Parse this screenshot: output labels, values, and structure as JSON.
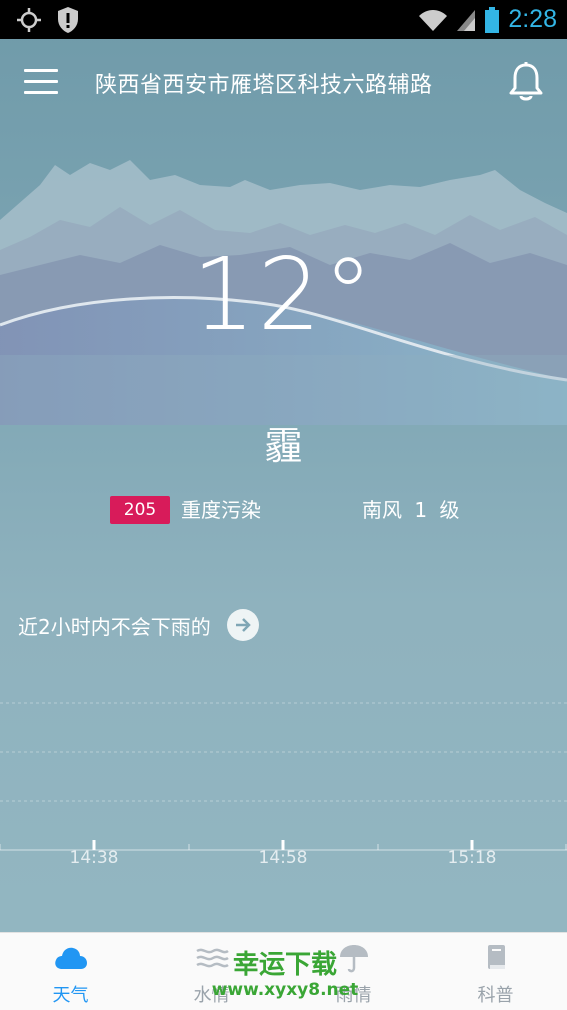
{
  "status_bar": {
    "time": "2:28",
    "icons": [
      "gps-icon",
      "shield-icon",
      "wifi-icon",
      "signal-icon",
      "battery-icon"
    ]
  },
  "header": {
    "location": "陕西省西安市雁塔区科技六路辅路",
    "menu_icon": "menu-icon",
    "bell_icon": "bell-icon"
  },
  "weather": {
    "temperature": "12",
    "degree_symbol": "°",
    "condition": "霾",
    "aqi_value": "205",
    "aqi_label": "重度污染",
    "wind": "南风 1 级",
    "aqi_color": "#d81b5a"
  },
  "rain": {
    "message": "近2小时内不会下雨的",
    "arrow_icon": "arrow-right-icon"
  },
  "chart": {
    "time_labels": [
      "14:38",
      "14:58",
      "15:18"
    ]
  },
  "bottom_nav": {
    "items": [
      {
        "label": "天气",
        "icon": "cloud-icon",
        "active": true
      },
      {
        "label": "水情",
        "icon": "water-icon",
        "active": false
      },
      {
        "label": "雨情",
        "icon": "umbrella-icon",
        "active": false
      },
      {
        "label": "科普",
        "icon": "book-icon",
        "active": false
      }
    ],
    "active_color": "#2196f3"
  },
  "watermark": {
    "title": "幸运下载",
    "url": "www.xyxy8.net"
  }
}
